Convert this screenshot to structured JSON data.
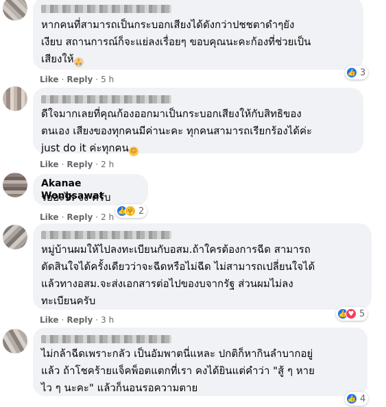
{
  "actions": {
    "like": "Like",
    "reply": "Reply",
    "sep": "·"
  },
  "comments": [
    {
      "name": "",
      "lines": [
        "หากคนที่สามารถเป็นกระบอกเสียงได้ดังกว่าปชชตาดำๆยัง",
        "เงียบ สถานการณ์ก็จะแย่ลงเรื่อยๆ ขอบคุณนะคะก้องที่ช่วยเป็น",
        "เสียงให้"
      ],
      "trailing_emoji": "folded-hands",
      "time": "5 h",
      "reactions": {
        "icons": [
          "like"
        ],
        "count": "3"
      }
    },
    {
      "name": "",
      "lines": [
        "ดีใจมากเลยที่คุณก้องออกมาเป็นกระบอกเสียงให้กับสิทธิของ",
        "ตนเอง เสียงของทุกคนมีค่านะคะ ทุกคนสามารถเรียกร้องได้ค่ะ",
        "just do it ค่ะทุกคน"
      ],
      "trailing_emoji": "smiling-face",
      "time": "2 h",
      "reactions": null
    },
    {
      "name": "Akanae Wongsawat",
      "lines": [
        "รออะไร งง ครับ"
      ],
      "time": "2 h",
      "reactions": {
        "icons": [
          "like",
          "care"
        ],
        "count": "2"
      }
    },
    {
      "name": "",
      "lines": [
        "หมู่บ้านผมให้ไปลงทะเบียนกับอสม.ถ้าใครต้องการฉีด สามารถ",
        "ตัดสินใจได้ครั้งเดียวว่าจะฉีดหรือไม่ฉีด ไม่สามารถเปลี่ยนใจได้",
        "แล้วทางอสม.จะส่งเอกสารต่อไปของบจากรัฐ ส่วนผมไม่ลง",
        "ทะเบียนครับ"
      ],
      "time": "3 h",
      "reactions": {
        "icons": [
          "like",
          "love"
        ],
        "count": "5"
      }
    },
    {
      "name": "",
      "lines": [
        "ไม่กล้าฉีดเพราะกลัว เป็นอัมพาตนี่แหละ ปกติก็หากินลำบากอยู่",
        "แล้ว ถ้าโชคร้ายแจ็คพ็อตแตกที่เรา คงได้ยินแต่คำว่า \"สู้ ๆ หาย",
        "ไว ๆ นะคะ\" แล้วก็นอนรอความตาย"
      ],
      "time": "",
      "reactions": {
        "icons": [
          "like"
        ],
        "count": "4"
      }
    }
  ]
}
